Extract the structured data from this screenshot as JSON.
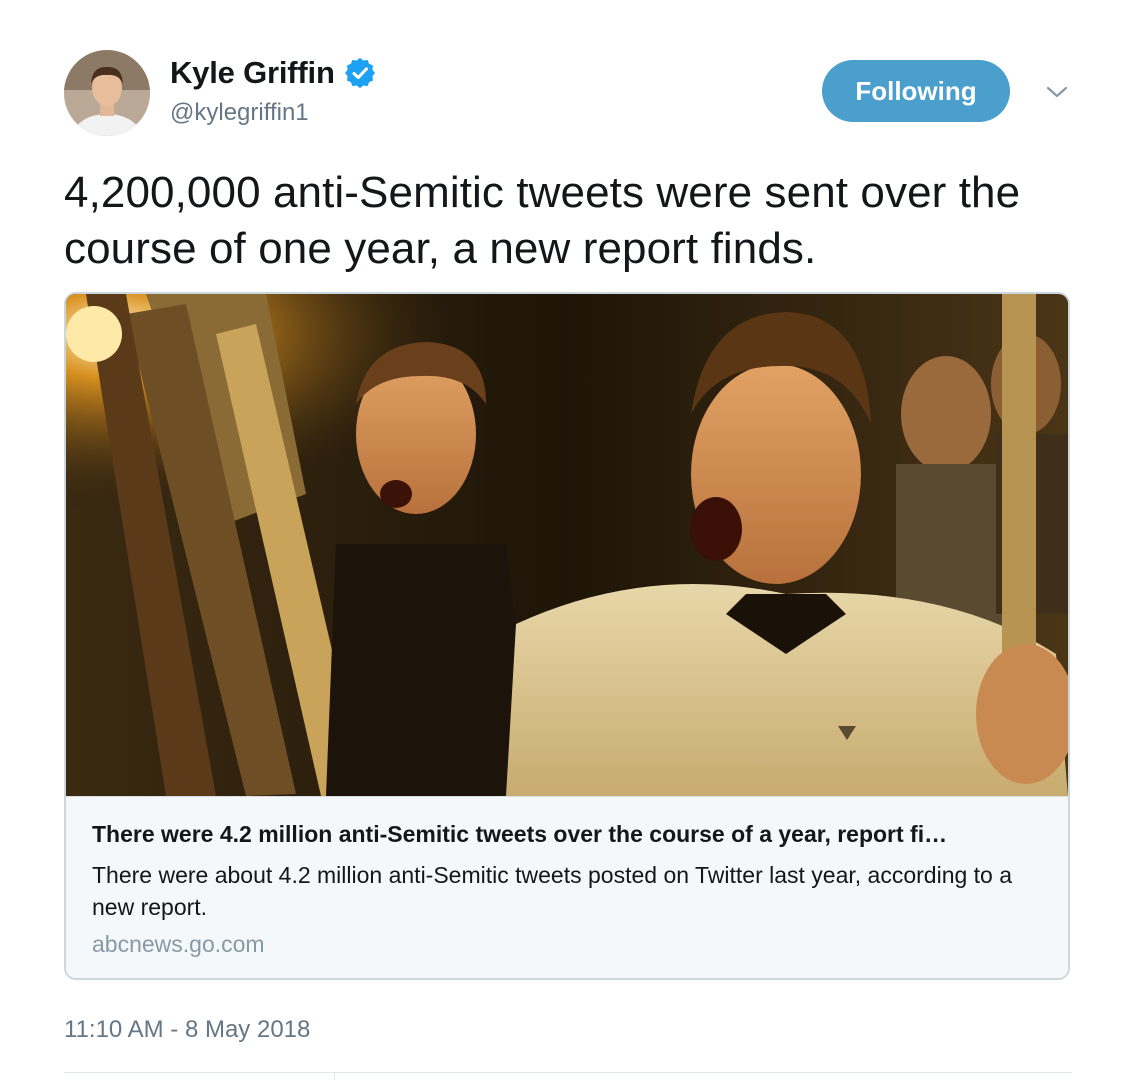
{
  "author": {
    "display_name": "Kyle Griffin",
    "handle": "@kylegriffin1",
    "verified": true
  },
  "follow_button": {
    "label": "Following"
  },
  "tweet": {
    "text": "4,200,000 anti-Semitic tweets were sent over the course of one year, a new report finds.",
    "timestamp": "11:10 AM - 8 May 2018"
  },
  "card": {
    "title": "There were 4.2 million anti-Semitic tweets over the course of a year, report fi…",
    "description": "There were about 4.2 million anti-Semitic tweets posted on Twitter last year, according to a new report.",
    "domain": "abcnews.go.com"
  },
  "colors": {
    "follow_button_bg": "#4a9fcc",
    "verified_badge": "#1da1f2",
    "secondary_text": "#657786",
    "card_bg": "#f5f8fa",
    "card_border": "#ccd6dd"
  },
  "icons": {
    "verified": "verified-badge-icon",
    "caret": "chevron-down-icon"
  }
}
